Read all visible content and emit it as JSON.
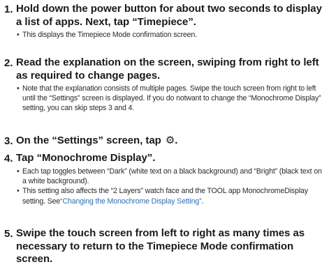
{
  "steps": [
    {
      "number": "1.",
      "title": "Hold down the power button for about two seconds to display a list of apps. Next, tap “Timepiece”.",
      "notes": [
        "This displays the Timepiece Mode confirmation screen."
      ]
    },
    {
      "number": "2.",
      "title": "Read the explanation on the screen, swiping from right to left as required to change pages.",
      "notes": [
        "Note that the explanation consists of multiple pages. Swipe the touch screen from right to left until the “Settings” screen is displayed. If you do notwant to change the “Monochrome Display” setting, you can skip steps 3 and 4."
      ]
    },
    {
      "number": "3.",
      "title": "On the “Settings” screen, tap",
      "icon": "gear-icon",
      "icon_glyph": "⚙.",
      "notes": []
    },
    {
      "number": "4.",
      "title": "Tap “Monochrome Display”.",
      "notes": [
        "Each tap toggles between “Dark” (white text on a black background) and “Bright” (black text on a white background).",
        "This setting also affects the “2 Layers” watch face and the TOOL app MonochromeDisplay setting. See"
      ],
      "link_text": "“Changing the Monochrome Display Setting”",
      "link_suffix": "."
    },
    {
      "number": "5.",
      "title": "Swipe the touch screen from left to right as many times as necessary to return to the Timepiece Mode confirmation screen.",
      "notes": []
    }
  ],
  "bullet": "•",
  "colors": {
    "text": "#1a1a1a",
    "note_text": "#2a2a2a",
    "link": "#2f6fb5"
  }
}
